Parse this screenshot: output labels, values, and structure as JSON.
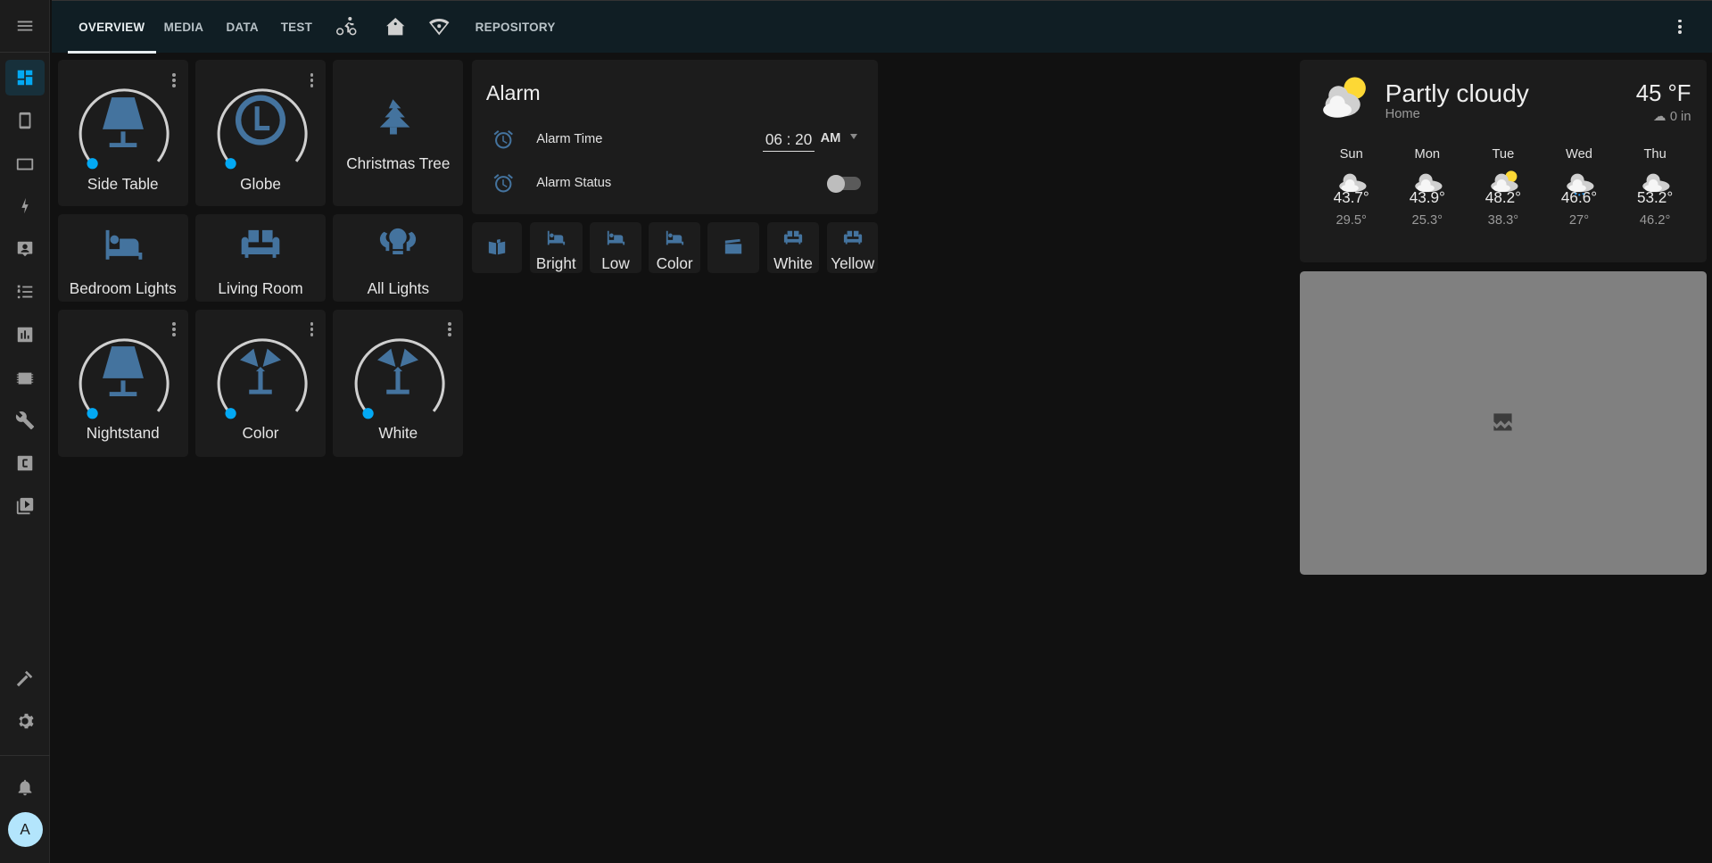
{
  "header": {
    "tabs": [
      {
        "label": "OVERVIEW",
        "active": true
      },
      {
        "label": "MEDIA"
      },
      {
        "label": "DATA"
      },
      {
        "label": "TEST"
      },
      {
        "icon": "bike-icon"
      },
      {
        "icon": "home-assistant-icon"
      },
      {
        "icon": "wifi-marker-icon"
      },
      {
        "label": "REPOSITORY"
      }
    ]
  },
  "sidebar": {
    "items": [
      "overview",
      "phone",
      "tablet",
      "energy",
      "person",
      "list",
      "history",
      "chip",
      "wrench",
      "c-box",
      "media"
    ],
    "bottom": [
      "developer-tools",
      "settings",
      "notifications"
    ],
    "avatar": "A"
  },
  "tiles": [
    {
      "name": "Side Table",
      "icon": "lamp-icon",
      "gauge": true
    },
    {
      "name": "Globe",
      "icon": "globe-l-icon",
      "gauge": true
    },
    {
      "name": "Christmas Tree",
      "icon": "pine-tree-icon"
    },
    {
      "name": "Bedroom Lights",
      "icon": "bed-icon"
    },
    {
      "name": "Living Room",
      "icon": "sofa-icon"
    },
    {
      "name": "All Lights",
      "icon": "lightbulb-group-icon"
    },
    {
      "name": "Nightstand",
      "icon": "lamp-icon",
      "gauge": true
    },
    {
      "name": "Color",
      "icon": "floor-lamp-icon",
      "gauge": true
    },
    {
      "name": "White",
      "icon": "floor-lamp-icon",
      "gauge": true
    }
  ],
  "alarm": {
    "title": "Alarm",
    "time_label": "Alarm Time",
    "time_value": "06 : 20",
    "ampm": "AM",
    "status_label": "Alarm Status",
    "status_on": false
  },
  "scene_buttons": [
    {
      "icon": "book-open-icon",
      "label": ""
    },
    {
      "icon": "bed-icon",
      "label": "Bright"
    },
    {
      "icon": "bed-icon",
      "label": "Low"
    },
    {
      "icon": "bed-icon",
      "label": "Color"
    },
    {
      "icon": "movie-clapper-icon",
      "label": ""
    },
    {
      "icon": "sofa-icon",
      "label": "White"
    },
    {
      "icon": "sofa-icon",
      "label": "Yellow"
    }
  ],
  "weather": {
    "condition": "Partly cloudy",
    "location": "Home",
    "temperature": "45 °F",
    "precipitation": "0 in",
    "forecast": [
      {
        "day": "Sun",
        "hi": "43.7°",
        "lo": "29.5°",
        "icon": "cloudy"
      },
      {
        "day": "Mon",
        "hi": "43.9°",
        "lo": "25.3°",
        "icon": "cloudy"
      },
      {
        "day": "Tue",
        "hi": "48.2°",
        "lo": "38.3°",
        "icon": "partly-cloudy"
      },
      {
        "day": "Wed",
        "hi": "46.6°",
        "lo": "27°",
        "icon": "rainy"
      },
      {
        "day": "Thu",
        "hi": "53.2°",
        "lo": "46.2°",
        "icon": "cloudy"
      }
    ]
  },
  "colors": {
    "accent": "#03a9f4",
    "icon": "#44739e",
    "card": "#1c1c1c",
    "bg": "#111111",
    "header": "#101e24"
  }
}
